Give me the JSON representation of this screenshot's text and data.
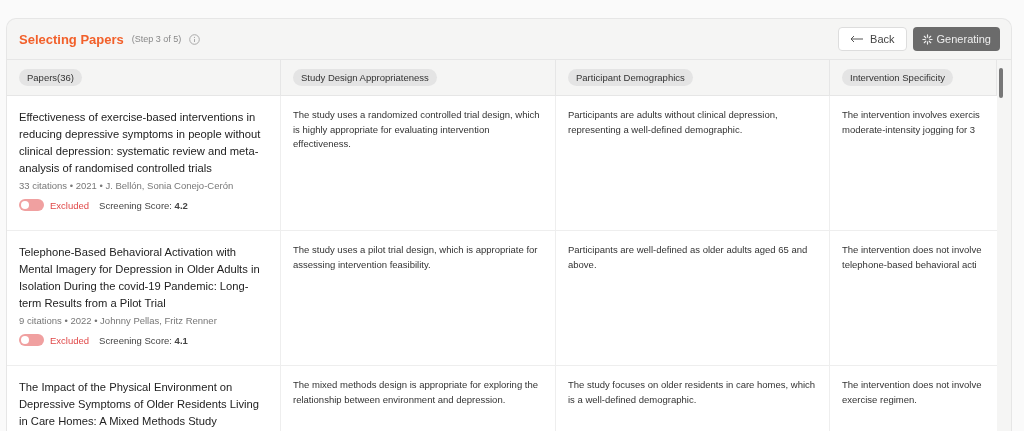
{
  "header": {
    "title": "Selecting Papers",
    "step": "(Step 3 of 5)",
    "back_button": "Back",
    "generate_button": {
      "label": "Generating",
      "busy": true
    }
  },
  "columns": [
    "Papers(36)",
    "Study Design Appropriateness",
    "Participant Demographics",
    "Intervention Specificity"
  ],
  "rows": [
    {
      "title": "Effectiveness of exercise-based interventions in reducing depressive symptoms in people without clinical depression: systematic review and meta-analysis of randomised controlled trials",
      "meta": "33 citations • 2021 • J. Bellón, Sonia Conejo-Cerón",
      "included": false,
      "status": "Excluded",
      "score_label": "Screening Score:",
      "score": "4.2",
      "design": "The study uses a randomized controlled trial design, which is highly appropriate for evaluating intervention effectiveness.",
      "demographics": "Participants are adults without clinical depression, representing a well-defined demographic.",
      "intervention": [
        "The intervention involves exercis",
        "moderate-intensity jogging for 3"
      ]
    },
    {
      "title": "Telephone-Based Behavioral Activation with Mental Imagery for Depression in Older Adults in Isolation During the covid-19 Pandemic: Long-term Results from a Pilot Trial",
      "meta": "9 citations • 2022 • Johnny Pellas, Fritz Renner",
      "included": false,
      "status": "Excluded",
      "score_label": "Screening Score:",
      "score": "4.1",
      "design": "The study uses a pilot trial design, which is appropriate for assessing intervention feasibility.",
      "demographics": "Participants are well-defined as older adults aged 65 and above.",
      "intervention": [
        "The intervention does not involve",
        "telephone-based behavioral acti"
      ]
    },
    {
      "title": "The Impact of the Physical Environment on Depressive Symptoms of Older Residents Living in Care Homes: A Mixed Methods Study",
      "design": "The mixed methods design is appropriate for exploring the relationship between environment and depression.",
      "demographics": "The study focuses on older residents in care homes, which is a well-defined demographic.",
      "intervention": [
        "The intervention does not involve",
        "exercise regimen."
      ]
    }
  ]
}
